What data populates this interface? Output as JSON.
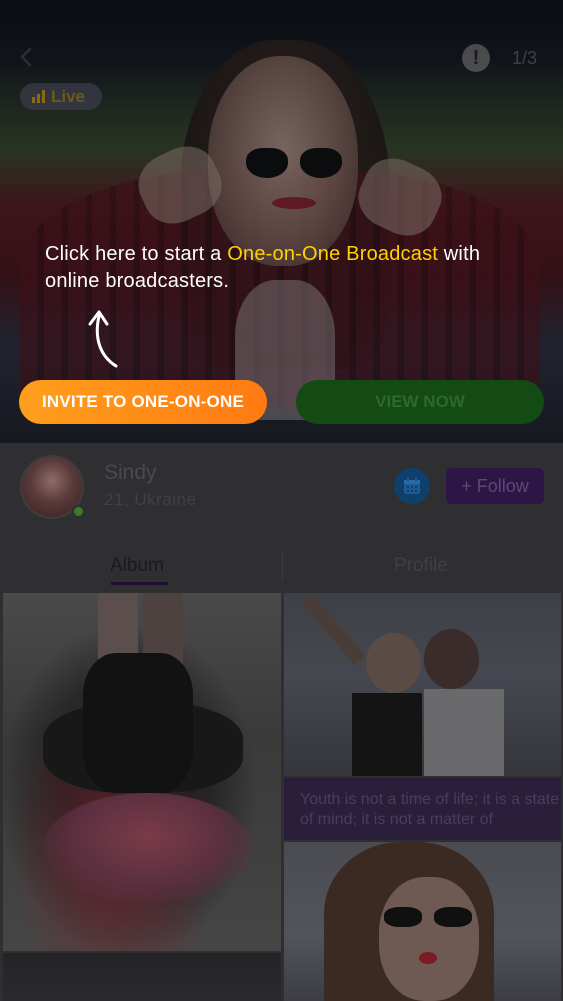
{
  "header": {
    "counter": "1/3",
    "live_label": "Live"
  },
  "tooltip": {
    "text_before": "Click here to start a ",
    "highlight": "One-on-One Broadcast",
    "text_after": " with online broadcasters."
  },
  "actions": {
    "invite_label": "INVITE TO ONE-ON-ONE",
    "view_label": "VIEW NOW"
  },
  "profile": {
    "name": "Sindy",
    "subtitle": "21, Ukraine",
    "follow_label": "+ Follow"
  },
  "tabs": {
    "album_label": "Album",
    "profile_label": "Profile"
  },
  "album": {
    "quote": "Youth is not a time of life; it is a state of mind; it is not a matter of"
  },
  "colors": {
    "invite_button": "#ff8c17",
    "highlight_text": "#ffd200",
    "follow_button": "#2d1546",
    "calendar_button": "#0f3f6b",
    "online_indicator": "#3f7a2a"
  },
  "icons": {
    "back": "chevron-left-icon",
    "report": "exclamation-icon",
    "live": "signal-bars-icon",
    "calendar": "calendar-icon",
    "tip_arrow": "curved-arrow-icon"
  }
}
